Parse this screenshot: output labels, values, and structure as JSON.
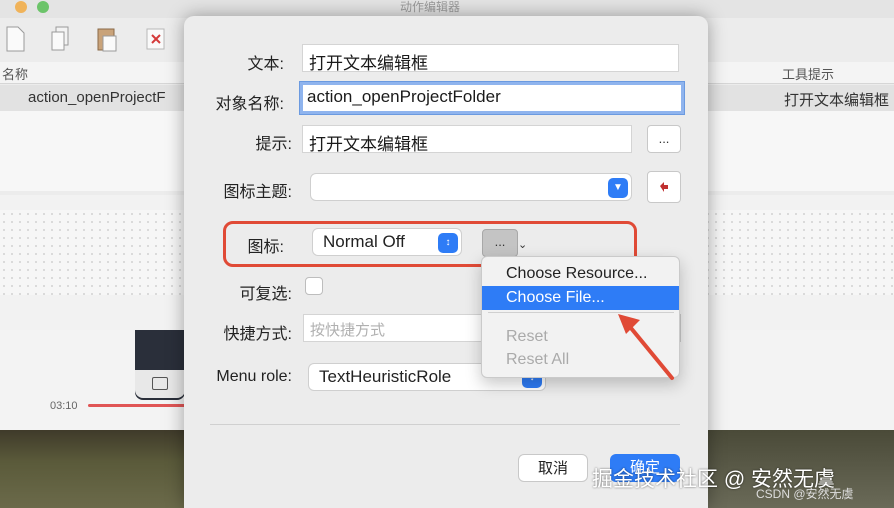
{
  "background_window": {
    "title": "动作编辑器",
    "table": {
      "col_name_header": "名称",
      "col_tooltip_header": "工具提示",
      "row_name": "action_openProjectF",
      "row_tooltip": "打开文本编辑框"
    },
    "video": {
      "time": "03:10"
    },
    "icons": [
      "new-file-icon",
      "copy-icon",
      "paste-icon",
      "delete-icon"
    ]
  },
  "dialog": {
    "text_label": "文本:",
    "text_value": "打开文本编辑框",
    "object_name_label": "对象名称:",
    "object_name_value": "action_openProjectFolder",
    "tooltip_label": "提示:",
    "tooltip_value": "打开文本编辑框",
    "tooltip_browse": "...",
    "icon_theme_label": "图标主题:",
    "icon_theme_value": "",
    "icon_label": "图标:",
    "icon_mode_value": "Normal Off",
    "icon_browse": "...",
    "checkable_label": "可复选:",
    "shortcut_label": "快捷方式:",
    "shortcut_placeholder": "按快捷方式",
    "menu_role_label": "Menu role:",
    "menu_role_value": "TextHeuristicRole",
    "cancel_button": "取消",
    "ok_button": "确定"
  },
  "context_menu": {
    "items": [
      {
        "label": "Choose Resource...",
        "state": "normal"
      },
      {
        "label": "Choose File...",
        "state": "selected"
      },
      {
        "label": "Reset",
        "state": "disabled"
      },
      {
        "label": "Reset All",
        "state": "disabled"
      }
    ]
  },
  "watermark": {
    "main": "掘金技术社区 @ 安然无虞",
    "sub": "CSDN @安然无虞"
  },
  "colors": {
    "accent": "#2e7cf6",
    "annotation": "#e04a36"
  }
}
